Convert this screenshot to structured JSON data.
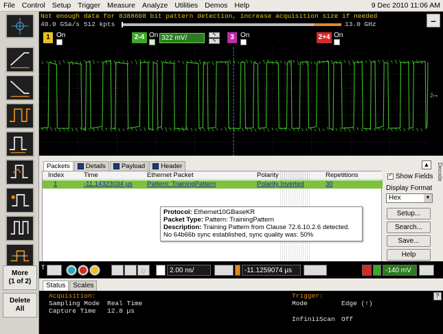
{
  "menu": {
    "items": [
      "File",
      "Control",
      "Setup",
      "Trigger",
      "Measure",
      "Analyze",
      "Utilities",
      "Demos",
      "Help"
    ],
    "datetime": "9 Dec 2010 11:06 AM"
  },
  "status": {
    "warning": "Not enough data for 8388608 bit pattern detection, increase acquisition size if needed",
    "sample_rate": "40.0 GSa/s   512 kpts",
    "bandwidth": "13.0 GHz",
    "minimize": "–"
  },
  "channels": [
    {
      "num": "1",
      "label": "On",
      "color": "#e8c21b"
    },
    {
      "num": "2-4",
      "label": "On",
      "value": "322 mV/",
      "color": "#3fa62a"
    },
    {
      "num": "3",
      "label": "On",
      "color": "#c02aa6"
    },
    {
      "num": "2+4",
      "label": "On",
      "color": "#d12a2a"
    }
  ],
  "left_toolbar": {
    "more": "More",
    "more_sub": "(1 of 2)",
    "delete": "Delete",
    "delete_sub": "All"
  },
  "decode": {
    "tabs": [
      "Packets",
      "Details",
      "Payload",
      "Header"
    ],
    "columns": [
      "Index",
      "Time",
      "Ethernet Packet",
      "Polarity",
      "Repetitions"
    ],
    "row": {
      "index": "1",
      "time": "-11.14323034 µs",
      "packet": "Pattern: TrainingPattern",
      "polarity": "Polarity Inverted",
      "repetitions": "30"
    },
    "tooltip": {
      "protocol_label": "Protocol:",
      "protocol": "Ethernet10GBaseKR",
      "type_label": "Packet Type:",
      "type": "Pattern: TrainingPattern",
      "desc_label": "Description:",
      "desc": "Training Pattern from Clause 72.6.10.2.6 detected.",
      "note": "No 64b66b sync established, sync quality was: 50%"
    },
    "show_fields": "Show Fields",
    "display_format_label": "Display Format",
    "display_format": "Hex",
    "buttons": [
      "Setup...",
      "Search...",
      "Save...",
      "Help"
    ],
    "side_label": "Decode"
  },
  "controls": {
    "timebase": "2.00 ns/",
    "delay": "-11.1259074 µs",
    "trigger_level": "-140 mV"
  },
  "bottom": {
    "tabs": [
      "Status",
      "Scales"
    ],
    "acquisition_label": "Acquisition:",
    "sampling_mode_label": "Sampling Mode",
    "sampling_mode": "Real Time",
    "capture_time_label": "Capture Time",
    "capture_time": "12.8 µs",
    "trigger_label": "Trigger:",
    "mode_label": "Mode",
    "mode": "Edge (↑)",
    "infiniiscan_label": "InfiniiScan",
    "infiniiscan": "Off",
    "help": "?"
  },
  "colors": {
    "waveform": "#3fbf2a",
    "selected_row": "#7cc23f",
    "warning": "#e8c21b"
  }
}
